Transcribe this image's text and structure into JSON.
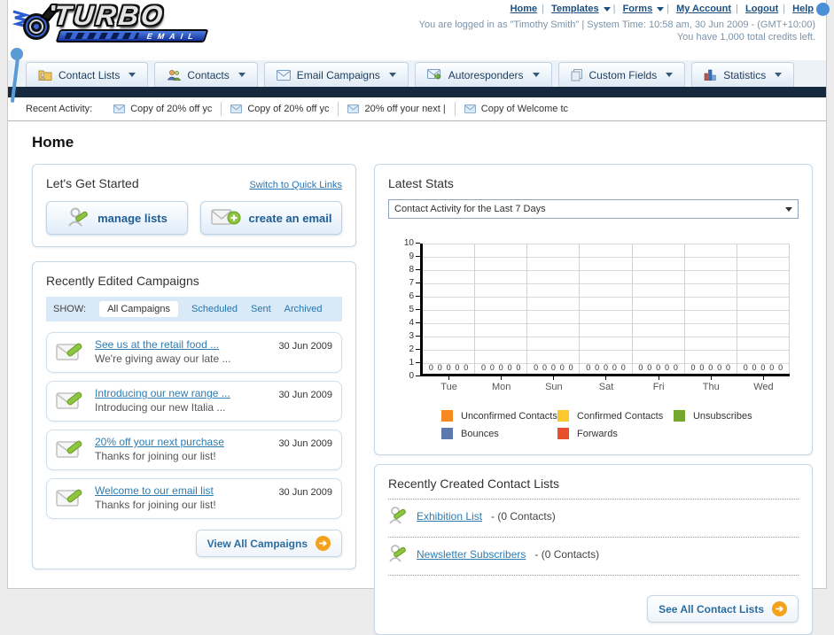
{
  "header": {
    "logo": {
      "title": "TURBO",
      "subtitle": "EMAIL",
      "icon": "turbocharger-icon"
    },
    "nav_links": [
      {
        "label": "Home",
        "dropdown": false
      },
      {
        "label": "Templates",
        "dropdown": true
      },
      {
        "label": "Forms",
        "dropdown": true
      },
      {
        "label": "My Account",
        "dropdown": false
      },
      {
        "label": "Logout",
        "dropdown": false
      },
      {
        "label": "Help",
        "dropdown": false
      }
    ],
    "login_status": "You are logged in as \"Timothy Smith\" | System Time: 10:58 am, 30 Jun 2009 - (GMT+10:00)",
    "credits": "You have 1,000 total credits left."
  },
  "nav_tabs": [
    {
      "label": "Contact Lists",
      "icon": "folder-contacts-icon"
    },
    {
      "label": "Contacts",
      "icon": "people-icon"
    },
    {
      "label": "Email Campaigns",
      "icon": "envelope-icon"
    },
    {
      "label": "Autoresponders",
      "icon": "envelope-arrow-icon"
    },
    {
      "label": "Custom Fields",
      "icon": "pages-icon"
    },
    {
      "label": "Statistics",
      "icon": "bar-chart-icon"
    }
  ],
  "recent_activity": {
    "label": "Recent Activity:",
    "items": [
      "Copy of 20% off yc",
      "Copy of 20% off yc",
      "20% off your next |",
      "Copy of Welcome tc"
    ]
  },
  "page_title": "Home",
  "get_started": {
    "title": "Let's Get Started",
    "switch_link": "Switch to Quick Links",
    "buttons": [
      {
        "label": "manage lists",
        "icon": "person-pencil-icon"
      },
      {
        "label": "create an email",
        "icon": "envelope-plus-icon"
      }
    ]
  },
  "campaigns": {
    "title": "Recently Edited Campaigns",
    "show_label": "SHOW:",
    "filters": [
      "All Campaigns",
      "Scheduled",
      "Sent",
      "Archived"
    ],
    "active_filter": "All Campaigns",
    "items": [
      {
        "title": "See us at the retail food ...",
        "subtitle": "We're giving away our late ...",
        "date": "30 Jun 2009"
      },
      {
        "title": "Introducing our new range ...",
        "subtitle": "Introducing our new Italia ...",
        "date": "30 Jun 2009"
      },
      {
        "title": "20% off your next purchase",
        "subtitle": "Thanks for joining our list!",
        "date": "30 Jun 2009"
      },
      {
        "title": "Welcome to our email list",
        "subtitle": "Thanks for joining our list!",
        "date": "30 Jun 2009"
      }
    ],
    "view_all_label": "View All Campaigns"
  },
  "latest_stats": {
    "title": "Latest Stats",
    "selected_option": "Contact Activity for the Last 7 Days"
  },
  "chart_data": {
    "type": "bar",
    "title": "Contact Activity for the Last 7 Days",
    "categories": [
      "Tue",
      "Mon",
      "Sun",
      "Sat",
      "Fri",
      "Thu",
      "Wed"
    ],
    "series": [
      {
        "name": "Unconfirmed Contacts",
        "color": "#F6891F",
        "values": [
          0,
          0,
          0,
          0,
          0,
          0,
          0
        ]
      },
      {
        "name": "Confirmed Contacts",
        "color": "#FBC92D",
        "values": [
          0,
          0,
          0,
          0,
          0,
          0,
          0
        ]
      },
      {
        "name": "Unsubscribes",
        "color": "#76A72E",
        "values": [
          0,
          0,
          0,
          0,
          0,
          0,
          0
        ]
      },
      {
        "name": "Bounces",
        "color": "#5C78AE",
        "values": [
          0,
          0,
          0,
          0,
          0,
          0,
          0
        ]
      },
      {
        "name": "Forwards",
        "color": "#E8502D",
        "values": [
          0,
          0,
          0,
          0,
          0,
          0,
          0
        ]
      }
    ],
    "xlabel": "",
    "ylabel": "",
    "ylim": [
      0,
      10
    ],
    "yticks": [
      0,
      1,
      2,
      3,
      4,
      5,
      6,
      7,
      8,
      9,
      10
    ],
    "grid": true,
    "legend_position": "bottom"
  },
  "contact_lists": {
    "title": "Recently Created Contact Lists",
    "items": [
      {
        "name": "Exhibition List",
        "suffix": "- (0 Contacts)"
      },
      {
        "name": "Newsletter Subscribers",
        "suffix": "- (0 Contacts)"
      }
    ],
    "see_all_label": "See All Contact Lists"
  },
  "colors": {
    "navy_bar": "#17293e",
    "panel_border": "#c6d7e6",
    "link_blue": "#2a77b5",
    "button_text": "#1d5d94",
    "arrow_circle": "#f5a21b"
  }
}
